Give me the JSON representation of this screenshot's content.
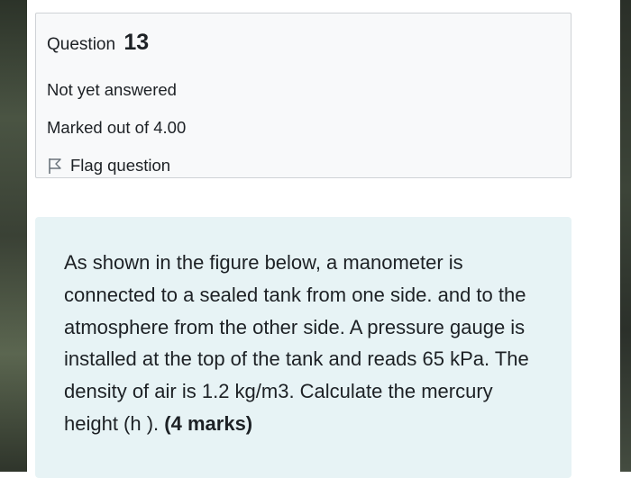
{
  "question_info": {
    "label": "Question",
    "number": "13",
    "state": "Not yet answered",
    "grade": "Marked out of 4.00",
    "flag_label": "Flag question",
    "flag_icon": "flag-outline-icon"
  },
  "question_text": {
    "body": "As shown in the figure below, a manometer is connected to a sealed tank from one side. and to the atmosphere from the other side. A pressure gauge is installed at the top of the tank and reads 65 kPa. The density of air is 1.2 kg/m3. Calculate the mercury height (h ).",
    "marks": "(4 marks)"
  },
  "colors": {
    "info_background": "#f8f9fa",
    "info_border": "#cfd2d6",
    "question_text_background": "#e7f3f5",
    "text": "#1d2125"
  }
}
